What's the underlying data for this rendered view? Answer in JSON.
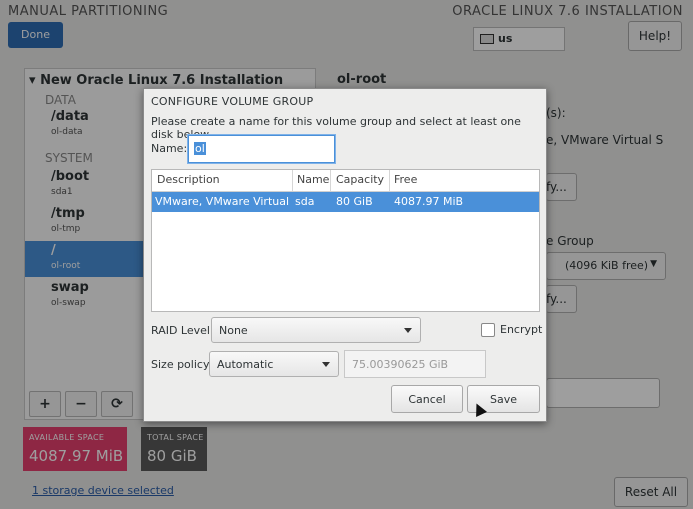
{
  "header": {
    "title": "MANUAL PARTITIONING",
    "product": "ORACLE LINUX 7.6 INSTALLATION",
    "done_label": "Done",
    "keyboard_layout": "us",
    "help_label": "Help!"
  },
  "left_panel": {
    "install_title": "New Oracle Linux 7.6 Installation",
    "sections": [
      "DATA",
      "SYSTEM"
    ],
    "mounts": [
      {
        "mount": "/data",
        "device": "ol-data"
      },
      {
        "mount": "/boot",
        "device": "sda1"
      },
      {
        "mount": "/tmp",
        "device": "ol-tmp"
      },
      {
        "mount": "/",
        "device": "ol-root"
      },
      {
        "mount": "swap",
        "device": "ol-swap"
      }
    ],
    "tools": {
      "add": "+",
      "remove": "−",
      "refresh": "⟳"
    }
  },
  "right_panel": {
    "title": "ol-root",
    "fragments": {
      "a": "(s):",
      "b": "e, VMware Virtual S",
      "c": "fy...",
      "d": "e Group",
      "e": "(4096 KiB free)",
      "f": "fy..."
    }
  },
  "space": {
    "available_label": "AVAILABLE SPACE",
    "available_value": "4087.97 MiB",
    "total_label": "TOTAL SPACE",
    "total_value": "80 GiB"
  },
  "storage_link": "1 storage device selected",
  "reset_label": "Reset All",
  "dialog": {
    "title": "CONFIGURE VOLUME GROUP",
    "subtitle": "Please create a name for this volume group and select at least one disk below.",
    "name_label": "Name:",
    "name_value": "ol",
    "columns": [
      "Description",
      "Name",
      "Capacity",
      "Free"
    ],
    "rows": [
      {
        "description": "VMware, VMware Virtual S",
        "name": "sda",
        "capacity": "80 GiB",
        "free": "4087.97 MiB"
      }
    ],
    "raid_label": "RAID Level:",
    "raid_value": "None",
    "encrypt_label": "Encrypt",
    "size_policy_label": "Size policy:",
    "size_policy_value": "Automatic",
    "size_value": "75.00390625 GiB",
    "cancel_label": "Cancel",
    "save_label": "Save"
  }
}
